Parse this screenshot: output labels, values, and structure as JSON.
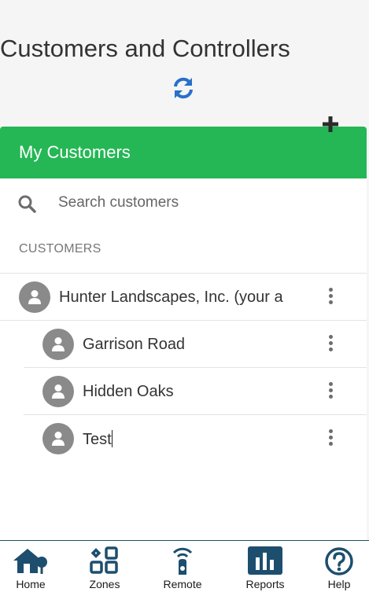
{
  "page": {
    "title": "Customers and Controllers"
  },
  "card": {
    "header": "My Customers",
    "search": {
      "placeholder": "Search customers",
      "value": ""
    },
    "section_label": "CUSTOMERS",
    "customers": [
      {
        "name": "Hunter Landscapes, Inc. (your a"
      },
      {
        "name": "Garrison Road"
      },
      {
        "name": "Hidden Oaks"
      },
      {
        "name": "Test"
      }
    ]
  },
  "tabs": [
    {
      "label": "Home",
      "icon": "home-icon"
    },
    {
      "label": "Zones",
      "icon": "zones-icon"
    },
    {
      "label": "Remote",
      "icon": "remote-icon"
    },
    {
      "label": "Reports",
      "icon": "reports-icon"
    },
    {
      "label": "Help",
      "icon": "help-icon"
    }
  ],
  "colors": {
    "header_green": "#25b755",
    "refresh_blue": "#2a6fc9",
    "nav_navy": "#1d4e6e",
    "avatar_gray": "#8a8a8a"
  }
}
